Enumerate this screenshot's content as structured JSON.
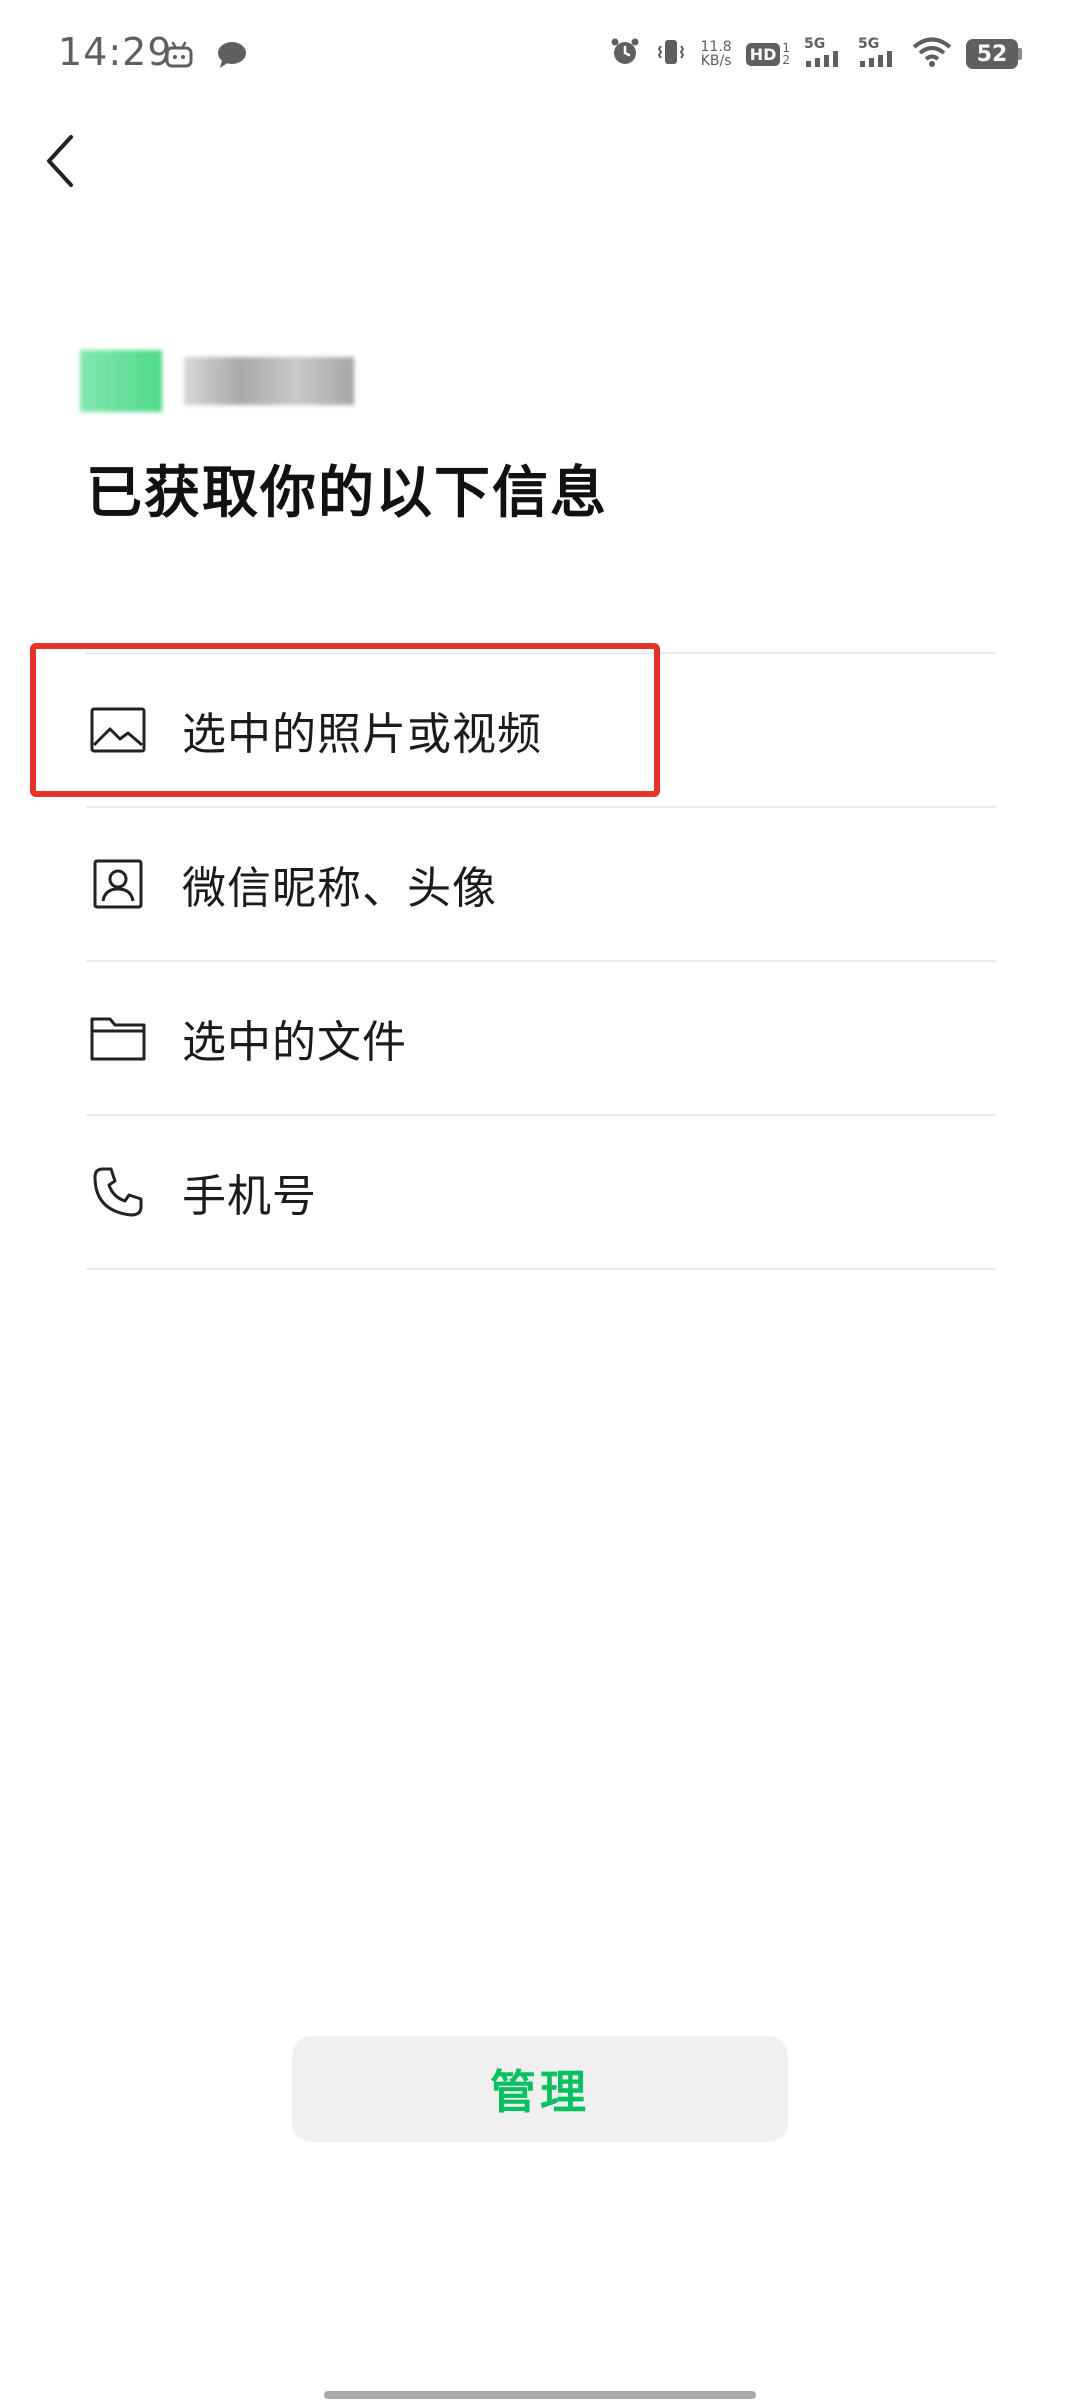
{
  "status_bar": {
    "time": "14:29",
    "net_speed_value": "11.8",
    "net_speed_unit": "KB/s",
    "hd_label": "HD",
    "hd_sub_top": "1",
    "hd_sub_bottom": "2",
    "signal1_label": "5G",
    "signal2_label": "5G",
    "battery_level": "52"
  },
  "header": {
    "title": "已获取你的以下信息"
  },
  "permissions": [
    {
      "label": "选中的照片或视频",
      "icon": "image-icon"
    },
    {
      "label": "微信昵称、头像",
      "icon": "profile-card-icon"
    },
    {
      "label": "选中的文件",
      "icon": "folder-icon"
    },
    {
      "label": "手机号",
      "icon": "phone-icon"
    }
  ],
  "actions": {
    "manage_label": "管理"
  },
  "colors": {
    "accent_green": "#07c160",
    "highlight_red": "#e4332b",
    "divider": "#ececec",
    "status_gray": "#5f5f5f"
  }
}
